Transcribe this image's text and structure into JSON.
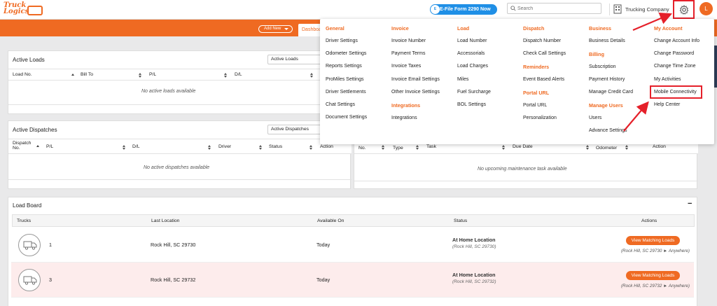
{
  "header": {
    "logo_text_top": "Truck",
    "logo_text_bottom": "Logics",
    "efile_badge": "E",
    "efile_label": "E-File Form 2290 Now",
    "search_placeholder": "Search",
    "company_name": "Trucking Company",
    "avatar_initial": "L",
    "add_new_label": "Add New",
    "dashboard_tab": "Dashboard"
  },
  "active_loads": {
    "title": "Active Loads",
    "select_value": "Active Loads",
    "columns": [
      "Load No.",
      "Bill To",
      "P/L",
      "D/L"
    ],
    "empty_text": "No active loads available"
  },
  "active_dispatches": {
    "title": "Active Dispatches",
    "select_value": "Active Dispatches",
    "columns": [
      "Dispatch No.",
      "P/L",
      "D/L",
      "Driver",
      "Status",
      "Action"
    ],
    "empty_text": "No active dispatches available"
  },
  "maintenance": {
    "columns": [
      "Unit No.",
      "Unit Type",
      "Task",
      "Due Date",
      "Due Odometer",
      "Action"
    ],
    "empty_text": "No upcoming maintenance task available"
  },
  "load_board": {
    "title": "Load Board",
    "collapse_label": "−",
    "columns": [
      "Trucks",
      "Last Location",
      "Available On",
      "Status",
      "Actions"
    ],
    "rows": [
      {
        "truck": "1",
        "last_location": "Rock Hill, SC 29730",
        "available_on": "Today",
        "status": "At Home Location",
        "status_sub": "(Rock Hill, SC 29730)",
        "action_label": "View Matching Loads",
        "route": "(Rock Hill, SC 29730 ► Anywhere)"
      },
      {
        "truck": "3",
        "last_location": "Rock Hill, SC 29732",
        "available_on": "Today",
        "status": "At Home Location",
        "status_sub": "(Rock Hill, SC 29732)",
        "action_label": "View Matching Loads",
        "route": "(Rock Hill, SC 29732 ► Anywhere)"
      }
    ]
  },
  "settings_menu": {
    "general": {
      "heading": "General",
      "items": [
        "Driver Settings",
        "Odometer Settings",
        "Reports Settings",
        "ProMiles Settings",
        "Driver Settlements",
        "Chat Settings",
        "Document Settings"
      ]
    },
    "invoice": {
      "heading": "Invoice",
      "items": [
        "Invoice Number",
        "Payment Terms",
        "Invoice Taxes",
        "Invoice Email Settings",
        "Other Invoice Settings"
      ],
      "integrations_heading": "Integrations",
      "integrations_items": [
        "Integrations"
      ]
    },
    "load": {
      "heading": "Load",
      "items": [
        "Load Number",
        "Accessorials",
        "Load Charges",
        "Miles",
        "Fuel Surcharge",
        "BOL Settings"
      ]
    },
    "dispatch": {
      "heading": "Dispatch",
      "items": [
        "Dispatch Number",
        "Check Call Settings"
      ],
      "reminders_heading": "Reminders",
      "reminders_items": [
        "Event Based Alerts"
      ],
      "portal_heading": "Portal URL",
      "portal_items": [
        "Portal URL",
        "Personalization"
      ]
    },
    "business": {
      "heading": "Business",
      "items": [
        "Business Details"
      ],
      "billing_heading": "Billing",
      "billing_items": [
        "Subscription",
        "Payment History",
        "Manage Credit Card"
      ],
      "users_heading": "Manage Users",
      "users_items": [
        "Users",
        "Advance Settings"
      ]
    },
    "my_account": {
      "heading": "My Account",
      "items": [
        "Change Account Info",
        "Change Password",
        "Change Time Zone",
        "My Activities",
        "Mobile Connectivity",
        "Help Center"
      ]
    }
  },
  "colors": {
    "accent": "#ef6a22",
    "highlight": "#e5202a",
    "efile_blue": "#1f8fe6",
    "row_alt": "#fdecec"
  }
}
